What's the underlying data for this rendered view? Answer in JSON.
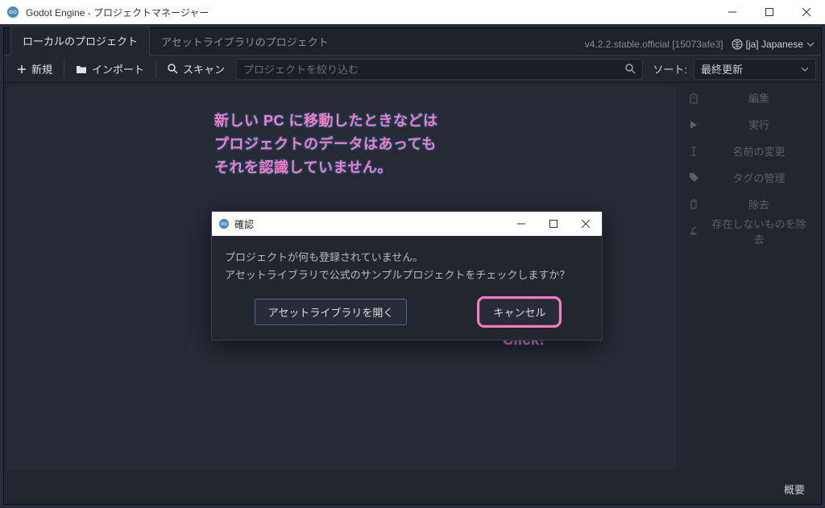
{
  "window": {
    "title": "Godot Engine - プロジェクトマネージャー"
  },
  "tabs": {
    "local": "ローカルのプロジェクト",
    "asset": "アセットライブラリのプロジェクト"
  },
  "header": {
    "version": "v4.2.2.stable.official [15073afe3]",
    "language": "[ja] Japanese"
  },
  "toolbar": {
    "new": "新規",
    "import": "インポート",
    "scan": "スキャン",
    "search_placeholder": "プロジェクトを絞り込む",
    "sort_label": "ソート:",
    "sort_value": "最終更新"
  },
  "side": {
    "edit": "編集",
    "run": "実行",
    "rename": "名前の変更",
    "tags": "タグの管理",
    "remove": "除去",
    "remove_missing": "存在しないものを除去"
  },
  "bottom": {
    "about": "概要"
  },
  "dialog": {
    "title": "確認",
    "line1": "プロジェクトが何も登録されていません。",
    "line2": "アセットライブラリで公式のサンプルプロジェクトをチェックしますか？",
    "open_assetlib": "アセットライブラリを開く",
    "cancel": "キャンセル"
  },
  "annotation": {
    "main": "新しい PC に移動したときなどは\nプロジェクトのデータはあっても\nそれを認識していません。",
    "click": "Click!"
  }
}
